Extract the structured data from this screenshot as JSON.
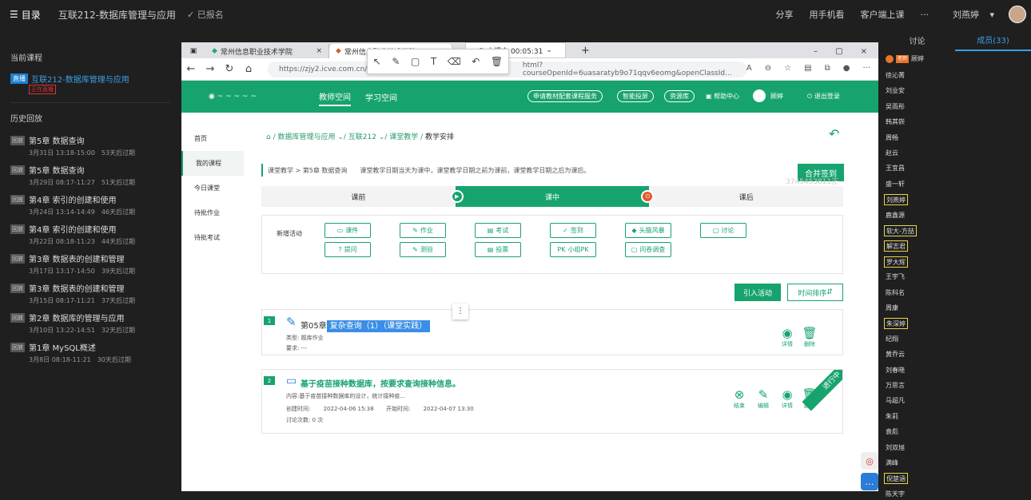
{
  "topbar": {
    "menu_label": "目录",
    "course_title": "互联212-数据库管理与应用",
    "registered": "✓ 已报名",
    "share": "分享",
    "mobile": "用手机看",
    "client": "客户端上课",
    "more": "···",
    "user": "刘燕婷"
  },
  "left": {
    "current_heading": "当前课程",
    "current_tag": "直播",
    "current_name": "互联212-数据库管理与应用",
    "live_badge": "正在直播",
    "history_heading": "历史回放",
    "history": [
      {
        "tag": "回放",
        "title": "第5章 数据查询",
        "date": "3月31日 13:18-15:00",
        "expire": "53天后过期"
      },
      {
        "tag": "回放",
        "title": "第5章 数据查询",
        "date": "3月29日 08:17-11:27",
        "expire": "51天后过期"
      },
      {
        "tag": "回放",
        "title": "第4章 索引的创建和使用",
        "date": "3月24日 13:14-14:49",
        "expire": "46天后过期"
      },
      {
        "tag": "回放",
        "title": "第4章 索引的创建和使用",
        "date": "3月22日 08:18-11:23",
        "expire": "44天后过期"
      },
      {
        "tag": "回放",
        "title": "第3章 数据表的创建和管理",
        "date": "3月17日 13:17-14:50",
        "expire": "39天后过期"
      },
      {
        "tag": "回放",
        "title": "第3章 数据表的创建和管理",
        "date": "3月15日 08:17-11:21",
        "expire": "37天后过期"
      },
      {
        "tag": "回放",
        "title": "第2章 数据库的管理与应用",
        "date": "3月10日 13:22-14:51",
        "expire": "32天后过期"
      },
      {
        "tag": "回放",
        "title": "第1章 MySQL概述",
        "date": "3月8日 08:18-11:21",
        "expire": "30天后过期"
      }
    ]
  },
  "browser": {
    "tab1": "常州信息职业技术学院",
    "tab2": "常州信息职业技术学院",
    "live_timer": "上课中 00:05:31",
    "url": "https://zjy2.icve.com.cn/tea",
    "url2": "html?courseOpenId=6uasaratyb9o71qqv6eomg&openClassId...",
    "header": {
      "nav1": "教师空间",
      "nav2": "学习空间",
      "btn1": "申请教材配套课程服务",
      "btn2": "智能投屏",
      "btn3": "资源库",
      "help": "帮助中心",
      "user": "顾婷",
      "logout": "退出登录"
    },
    "sidenav": [
      "首页",
      "我的课程",
      "今日课堂",
      "待批作业",
      "待批考试"
    ],
    "crumb": {
      "a": "数据库管理与应用",
      "b": "互联212",
      "c": "课堂教学",
      "d": "教学安排"
    },
    "info": "课堂教学 > 第5章 数据查询",
    "info_note": "课堂教学日期当天为课中，课堂教学日期之前为课前，课堂教学日期之后为课后。",
    "merge": "合并签到",
    "watermark": "3745453811正在观看",
    "stages": {
      "before": "课前",
      "during": "课中",
      "after": "课后"
    },
    "add_label": "新增活动",
    "acts": [
      "课件",
      "作业",
      "考试",
      "签到",
      "头脑风暴",
      "讨论",
      "提问",
      "测验",
      "投票",
      "小组PK",
      "问卷调查"
    ],
    "intro": "引入活动",
    "sort": "时间排序",
    "card1": {
      "num": "1",
      "title_prefix": "第05章",
      "title_sel": "复杂查询（1）（课堂实践）",
      "type": "类型:  题库作业",
      "req": "要求:  ---",
      "detail": "详情",
      "del": "删除"
    },
    "card2": {
      "num": "2",
      "title": "基于疫苗接种数据库，按要求查询接种信息。",
      "content": "内容:基于疫苗接种数据库的设计，统计接种疫...",
      "created_label": "创建时间:",
      "created": "2022-04-06 15:38",
      "start_label": "开始时间:",
      "start": "2022-04-07 13:30",
      "count": "讨论次数: 0 次",
      "ribbon": "进行中",
      "end": "结束",
      "edit": "编辑",
      "detail": "详情",
      "del": "删除"
    }
  },
  "right": {
    "tab1": "讨论",
    "tab2": "成员(33)",
    "teacher_tag": "老师",
    "teacher": "顾婷",
    "members": [
      "徐沁菁",
      "刘业安",
      "吴雨彤",
      "韩其嵚",
      "周畅",
      "赵云",
      "王宜昌",
      "盛一轩",
      "刘燕婷",
      "鹿鑫源",
      "软大-方喆",
      "解志君",
      "罗大辉",
      "王宇飞",
      "陈科名",
      "周康",
      "朱深婷",
      "纪翔",
      "黄乔云",
      "刘春晓",
      "万思言",
      "马超凡",
      "朱莉",
      "袁彪",
      "刘双旭",
      "满峰",
      "倪楚涵",
      "陈天宇"
    ]
  }
}
